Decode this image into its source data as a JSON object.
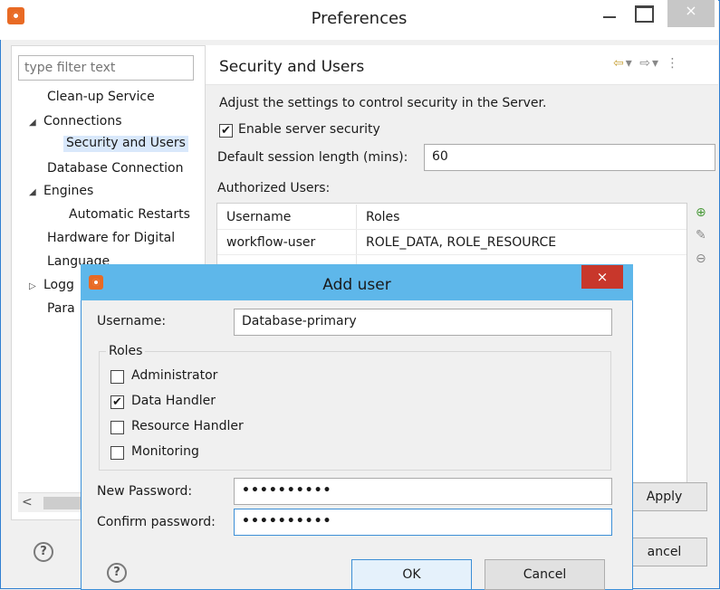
{
  "window": {
    "title": "Preferences",
    "close_glyph": "×"
  },
  "tree": {
    "filter_placeholder": "type filter text",
    "items": [
      "Clean-up Service",
      "Connections",
      "Security and Users",
      "Database Connection",
      "Engines",
      "Automatic Restarts",
      "Hardware for Digital",
      "Language",
      "Logg",
      "Para"
    ],
    "expand_glyph": "◢",
    "collapse_glyph": "▷",
    "scroll_left": "<"
  },
  "page": {
    "title": "Security and Users",
    "description": "Adjust the settings to control security in the Server.",
    "enable_security_label": "Enable server security",
    "enable_security_checked": true,
    "session_label": "Default session length (mins):",
    "session_value": "60",
    "authorized_label": "Authorized Users:",
    "table": {
      "headers": [
        "Username",
        "Roles"
      ],
      "rows": [
        {
          "username": "workflow-user",
          "roles": "ROLE_DATA, ROLE_RESOURCE"
        }
      ]
    },
    "apply_label": "Apply",
    "cancel_label": "ancel"
  },
  "dialog": {
    "title": "Add user",
    "close_glyph": "×",
    "username_label": "Username:",
    "username_value": "Database-primary",
    "roles_label": "Roles",
    "roles": [
      {
        "label": "Administrator",
        "checked": false
      },
      {
        "label": "Data Handler",
        "checked": true
      },
      {
        "label": "Resource Handler",
        "checked": false
      },
      {
        "label": "Monitoring",
        "checked": false
      }
    ],
    "new_password_label": "New Password:",
    "new_password_value": "••••••••••",
    "confirm_password_label": "Confirm password:",
    "confirm_password_value": "••••••••••",
    "ok_label": "OK",
    "cancel_label": "Cancel"
  },
  "icons": {
    "help_glyph": "?",
    "check_glyph": "✔"
  }
}
